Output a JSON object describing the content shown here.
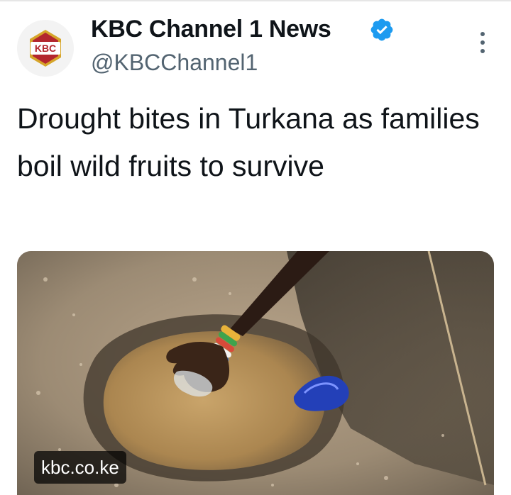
{
  "author": {
    "name": "KBC Channel 1 News",
    "handle": "@KBCChannel1",
    "verified": true,
    "avatar_logo_text": "KBC",
    "avatar_icon": "kbc-logo"
  },
  "tweet": {
    "text": "Drought bites in Turkana as families boil wild fruits to survive"
  },
  "media": {
    "domain": "kbc.co.ke",
    "image_description_icon": "photo-hand-in-water-hole"
  },
  "colors": {
    "verified_blue": "#1d9bf0",
    "handle_grey": "#536471",
    "text": "#0f1419",
    "logo_red": "#b3262e",
    "logo_gold": "#d6a52a"
  }
}
